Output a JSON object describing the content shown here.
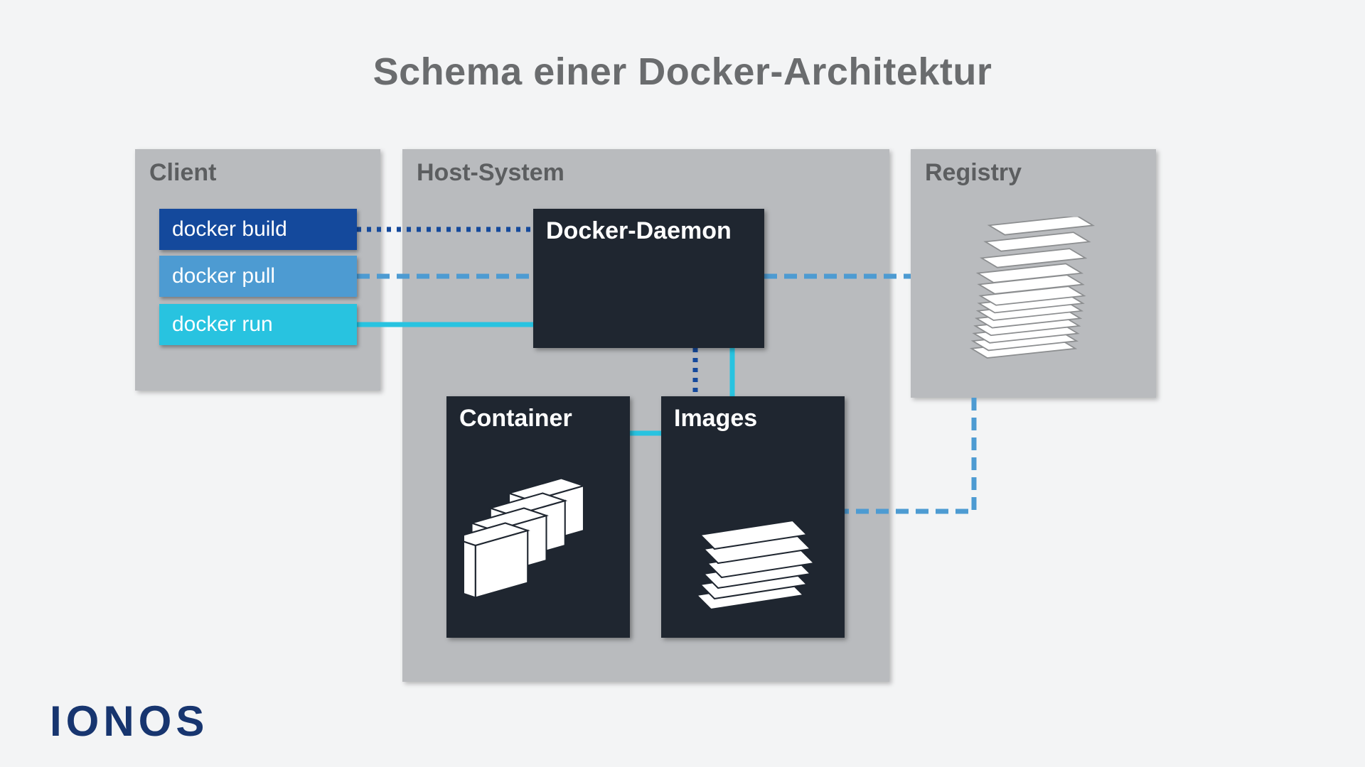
{
  "title": "Schema einer Docker-Architektur",
  "panels": {
    "client": {
      "label": "Client"
    },
    "host": {
      "label": "Host-System"
    },
    "registry": {
      "label": "Registry"
    }
  },
  "commands": {
    "build": {
      "label": "docker build",
      "color": "#14499c"
    },
    "pull": {
      "label": "docker pull",
      "color": "#4d9bd2"
    },
    "run": {
      "label": "docker run",
      "color": "#28c3e0"
    }
  },
  "boxes": {
    "daemon": {
      "label": "Docker-Daemon"
    },
    "container": {
      "label": "Container"
    },
    "images": {
      "label": "Images"
    }
  },
  "logo": "IONOS",
  "connections": [
    {
      "from": "docker build",
      "to": "Docker-Daemon",
      "style": "dotted",
      "color": "#14499c"
    },
    {
      "from": "docker pull",
      "to": "Docker-Daemon",
      "style": "dashed",
      "color": "#4d9bd2"
    },
    {
      "from": "docker pull",
      "through": "Docker-Daemon",
      "to": "Registry",
      "style": "dashed",
      "color": "#4d9bd2"
    },
    {
      "from": "docker run",
      "to": "Docker-Daemon",
      "style": "solid",
      "color": "#28c3e0"
    },
    {
      "from": "Docker-Daemon",
      "to": "Images",
      "style": "dotted",
      "color": "#14499c"
    },
    {
      "from": "Docker-Daemon",
      "to": "Images",
      "style": "solid",
      "color": "#28c3e0"
    },
    {
      "from": "Images",
      "to": "Container",
      "style": "solid",
      "color": "#28c3e0"
    },
    {
      "from": "Registry",
      "to": "Images",
      "style": "dashed",
      "color": "#4d9bd2"
    }
  ]
}
